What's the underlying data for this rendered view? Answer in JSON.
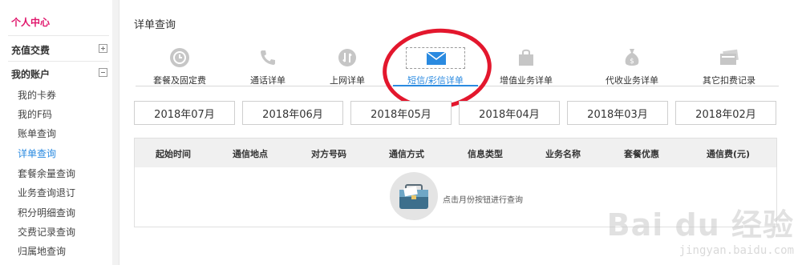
{
  "sidebar": {
    "title": "个人中心",
    "groups": [
      {
        "label": "充值交费",
        "toggle": "+"
      },
      {
        "label": "我的账户",
        "toggle": "−"
      }
    ],
    "items": [
      {
        "label": "我的卡券"
      },
      {
        "label": "我的F码"
      },
      {
        "label": "账单查询"
      },
      {
        "label": "详单查询",
        "active": true
      },
      {
        "label": "套餐余量查询"
      },
      {
        "label": "业务查询退订"
      },
      {
        "label": "积分明细查询"
      },
      {
        "label": "交费记录查询"
      },
      {
        "label": "归属地查询"
      }
    ]
  },
  "main": {
    "title": "详单查询",
    "categories": [
      {
        "label": "套餐及固定费",
        "icon": "clock-icon"
      },
      {
        "label": "通话详单",
        "icon": "phone-icon"
      },
      {
        "label": "上网详单",
        "icon": "data-arrows-icon"
      },
      {
        "label": "短信/彩信详单",
        "icon": "envelope-icon",
        "active": true
      },
      {
        "label": "增值业务详单",
        "icon": "shopping-bag-icon"
      },
      {
        "label": "代收业务详单",
        "icon": "money-bag-icon"
      },
      {
        "label": "其它扣费记录",
        "icon": "card-icon"
      }
    ],
    "months": [
      "2018年07月",
      "2018年06月",
      "2018年05月",
      "2018年04月",
      "2018年03月",
      "2018年02月"
    ],
    "table": {
      "headers": [
        "起始时间",
        "通信地点",
        "对方号码",
        "通信方式",
        "信息类型",
        "业务名称",
        "套餐优惠",
        "通信费(元)"
      ],
      "empty_text": "点击月份按钮进行查询"
    }
  },
  "watermark": {
    "big": "Bai du 经验",
    "small": "jingyan.baidu.com"
  },
  "colors": {
    "accent": "#2a8ae0",
    "title": "#e0156b",
    "annotation": "#e3172d"
  }
}
